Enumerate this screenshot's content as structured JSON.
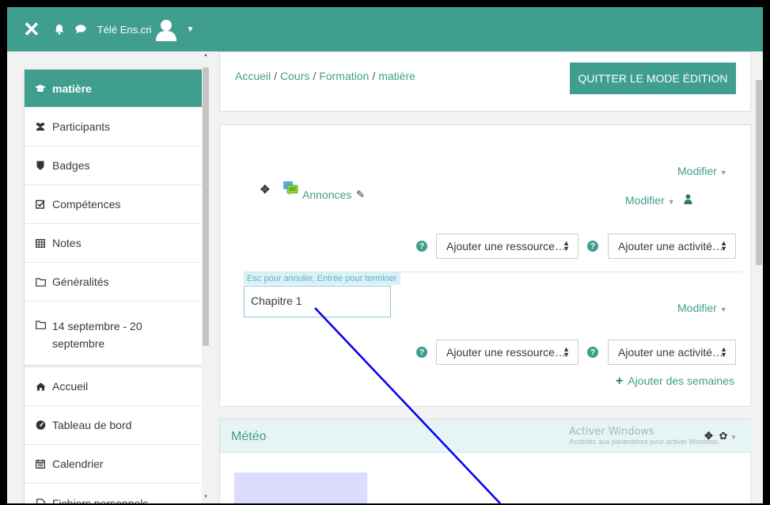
{
  "navbar": {
    "username": "Télé Ens.cri",
    "bg_color": "#3f9e8e"
  },
  "sidebar": {
    "group1": [
      {
        "label": "matière",
        "icon": "graduation-cap-icon",
        "active": true
      },
      {
        "label": "Participants",
        "icon": "users-icon"
      },
      {
        "label": "Badges",
        "icon": "shield-icon"
      },
      {
        "label": "Compétences",
        "icon": "checkbox-icon"
      },
      {
        "label": "Notes",
        "icon": "table-icon"
      },
      {
        "label": "Généralités",
        "icon": "folder-icon"
      },
      {
        "label": "14 septembre - 20 septembre",
        "icon": "folder-icon"
      }
    ],
    "group2": [
      {
        "label": "Accueil",
        "icon": "home-icon"
      },
      {
        "label": "Tableau de bord",
        "icon": "dashboard-icon"
      },
      {
        "label": "Calendrier",
        "icon": "calendar-icon"
      },
      {
        "label": "Fichiers personnels",
        "icon": "file-icon"
      }
    ]
  },
  "header": {
    "breadcrumb": [
      "Accueil",
      "Cours",
      "Formation",
      "matière"
    ],
    "edit_button": "QUITTER LE MODE ÉDITION"
  },
  "course": {
    "section0_modify": "Modifier",
    "activity_name": "Annonces",
    "activity_modify": "Modifier",
    "add_resource": "Ajouter une ressource…",
    "add_activity": "Ajouter une activité…",
    "edit_hint": "Esc pour annuler, Entrée pour terminer",
    "section1_name": "Chapitre 1",
    "section1_modify": "Modifier",
    "add_resource_2": "Ajouter une ressource…",
    "add_activity_2": "Ajouter une activité…",
    "add_weeks": "Ajouter des semaines"
  },
  "meteo": {
    "title": "Météo",
    "watermark_line1": "Activer Windows",
    "watermark_line2": "Accédez aux paramètres pour activer Windows."
  },
  "colors": {
    "accent": "#3f9e8e",
    "annotation_line": "#0000ee"
  }
}
